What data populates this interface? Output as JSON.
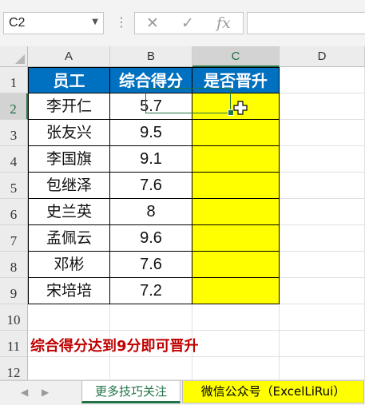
{
  "formula_bar": {
    "name_box": "C2",
    "cancel_icon": "✕",
    "enter_icon": "✓",
    "fx_label": "fx",
    "formula": ""
  },
  "columns": [
    "A",
    "B",
    "C",
    "D"
  ],
  "rows": [
    "1",
    "2",
    "3",
    "4",
    "5",
    "6",
    "7",
    "8",
    "9",
    "10",
    "11",
    "12"
  ],
  "headers": [
    "员工",
    "综合得分",
    "是否晋升"
  ],
  "employees": [
    {
      "name": "李开仁",
      "score": "5.7"
    },
    {
      "name": "张友兴",
      "score": "9.5"
    },
    {
      "name": "李国旗",
      "score": "9.1"
    },
    {
      "name": "包继泽",
      "score": "7.6"
    },
    {
      "name": "史兰英",
      "score": "8"
    },
    {
      "name": "孟佩云",
      "score": "9.6"
    },
    {
      "name": "邓彬",
      "score": "7.6"
    },
    {
      "name": "宋培培",
      "score": "7.2"
    }
  ],
  "note": "综合得分达到9分即可晋升",
  "sheet_tabs": [
    "更多技巧关注",
    "微信公众号（ExcelLiRui）"
  ],
  "colors": {
    "header_fill": "#0070c0",
    "highlight_fill": "#ffff00",
    "note_text": "#c00000",
    "accent": "#217346"
  }
}
